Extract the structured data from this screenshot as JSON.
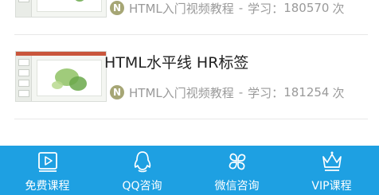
{
  "courses": [
    {
      "title": "",
      "source": "HTML入门视频教程",
      "separator": "-",
      "learn_label": "学习：",
      "count": "180570",
      "unit": "次"
    },
    {
      "title": "HTML水平线 HR标签",
      "source": "HTML入门视频教程",
      "separator": "-",
      "learn_label": "学习：",
      "count": "181254",
      "unit": "次"
    }
  ],
  "badge_letter": "N",
  "tabbar": {
    "items": [
      {
        "label": "免费课程",
        "icon": "play-icon"
      },
      {
        "label": "QQ咨询",
        "icon": "qq-penguin-icon"
      },
      {
        "label": "微信咨询",
        "icon": "wechat-clover-icon"
      },
      {
        "label": "VIP课程",
        "icon": "crown-icon"
      }
    ]
  },
  "colors": {
    "tabbar_bg": "#1ea0e2",
    "badge_bg": "#a6a675",
    "meta_text": "#9a9a9a"
  }
}
